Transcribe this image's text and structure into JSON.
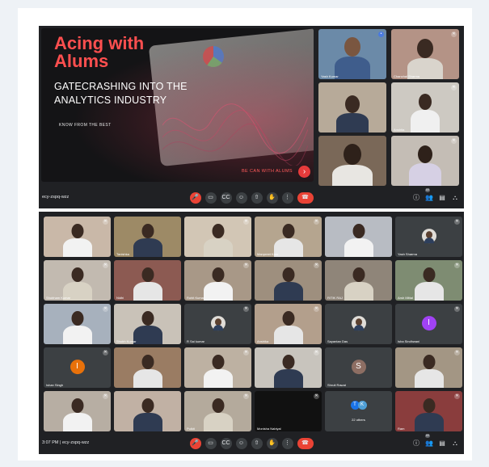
{
  "slide": {
    "title": "Acing with Alums",
    "subtitle": "GATECRASHING INTO THE ANALYTICS INDUSTRY",
    "tagline": "KNOW FROM THE BEST",
    "brand": "BE CAN WITH ALUMS",
    "arrow": "›"
  },
  "top_tiles": [
    {
      "name": "Yash Kumar",
      "bg": "#6b8aa8"
    },
    {
      "name": "Chanchal Sharma",
      "bg": "#b49386"
    },
    {
      "name": "",
      "bg": "#b7aa99"
    },
    {
      "name": "Anshita",
      "bg": "#cdc9c2"
    },
    {
      "name": "",
      "bg": "#7a6858"
    },
    {
      "name": "",
      "bg": "#c4bdb5"
    }
  ],
  "top_bar": {
    "meeting_code": "ecy-zspq-wzz",
    "participants_badge": "69"
  },
  "grid": [
    {
      "name": "",
      "bg": "#c9b8a8"
    },
    {
      "name": "Tanishka",
      "bg": "#9d8a66"
    },
    {
      "name": "",
      "bg": "#d2c6b5"
    },
    {
      "name": "Manpreet Kaur",
      "bg": "#b5a58f"
    },
    {
      "name": "",
      "bg": "#b8bcc3"
    },
    {
      "name": "Yash Sharma",
      "bg": "#3c4043",
      "avatar": "img"
    },
    {
      "name": "Shubham Kumar",
      "bg": "#c2bab0"
    },
    {
      "name": "Nidhi",
      "bg": "#8c5a52"
    },
    {
      "name": "Rohit Kumar",
      "bg": "#a89887"
    },
    {
      "name": "",
      "bg": "#9e8f7e"
    },
    {
      "name": "RITIK RAJ",
      "bg": "#8f8579"
    },
    {
      "name": "Arsh Mittal",
      "bg": "#7e8c72"
    },
    {
      "name": "",
      "bg": "#a7b1bd"
    },
    {
      "name": "Shubh Kumar",
      "bg": "#c9c2b8"
    },
    {
      "name": "R Sai kumar",
      "bg": "#3c4043",
      "avatar": "img"
    },
    {
      "name": "Anshika",
      "bg": "#b39f8c"
    },
    {
      "name": "Sayantan Das",
      "bg": "#3c4043",
      "avatar": "img"
    },
    {
      "name": "Isha Sindhwani",
      "bg": "#3c4043",
      "avatar": "I",
      "color": "#a142f4"
    },
    {
      "name": "Ishan Singh",
      "bg": "#3c4043",
      "avatar": "I",
      "color": "#e8710a"
    },
    {
      "name": "",
      "bg": "#9a7c63"
    },
    {
      "name": "",
      "bg": "#bdb1a2"
    },
    {
      "name": "",
      "bg": "#c8c4bd"
    },
    {
      "name": "Shruti Rawat",
      "bg": "#3c4043",
      "avatar": "S",
      "color": "#8d6e63"
    },
    {
      "name": "",
      "bg": "#a39684"
    },
    {
      "name": "",
      "bg": "#b7aea3"
    },
    {
      "name": "",
      "bg": "#c1b1a4"
    },
    {
      "name": "Pulkit",
      "bg": "#b4aa9c"
    },
    {
      "name": "Monisha Nabiyal",
      "bg": "#111111"
    },
    {
      "name": "22 others",
      "bg": "#3c4043",
      "others": [
        "T",
        "K"
      ]
    },
    {
      "name": "Ram",
      "bg": "#8a3d3d"
    }
  ],
  "bottom_bar": {
    "time": "3:07 PM",
    "meeting_code": "ecy-zspq-wzz",
    "participants_badge": "69"
  },
  "controls": {
    "mic": "🎤",
    "camera": "▭",
    "captions": "CC",
    "emoji": "☺",
    "present": "⇧",
    "hand": "✋",
    "more": "⋮",
    "end": "☎",
    "info": "ⓘ",
    "people": "👥",
    "chat": "▤",
    "activities": "⛬"
  }
}
